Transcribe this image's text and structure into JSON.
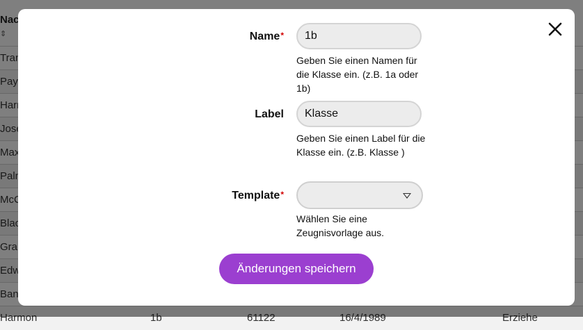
{
  "background": {
    "column_header": "Nac",
    "sort_glyph": "⇕",
    "rows": [
      "Tran",
      "Payn",
      "Harr",
      "Jose",
      "Max",
      "Paln",
      "McC",
      "Blac",
      "Gran",
      "Edw",
      "Ban"
    ],
    "bottom_row": [
      "Harmon",
      "1b",
      "61122",
      "16/4/1989",
      "Erziehe"
    ]
  },
  "modal": {
    "close_glyph": "✕",
    "name": {
      "label": "Name",
      "required_mark": "*",
      "value": "1b",
      "help": "Geben Sie einen Namen für die Klasse ein. (z.B. 1a oder 1b)"
    },
    "label_field": {
      "label": "Label",
      "value": "Klasse",
      "help": "Geben Sie einen Label für die Klasse ein. (z.B. Klasse )"
    },
    "template": {
      "label": "Template",
      "required_mark": "*",
      "selected": "",
      "help": "Wählen Sie eine Zeugnisvorlage aus."
    },
    "save_label": "Änderungen speichern"
  }
}
